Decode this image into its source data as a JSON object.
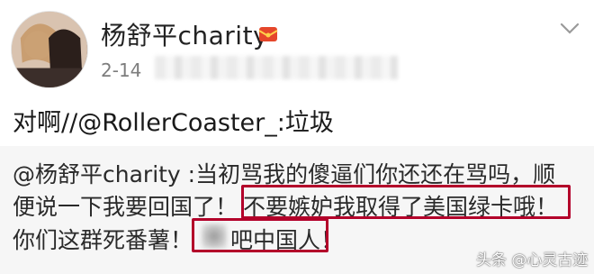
{
  "post": {
    "username": "杨舒平charity",
    "icons": {
      "badge": "vip-envelope-icon",
      "menu": "chevron-down-icon",
      "avatar": "profile-photo"
    },
    "date": "2-14",
    "repost_text_prefix": "对啊//",
    "repost_mention": "@RollerCoaster_",
    "repost_text_suffix": ":垃圾",
    "quoted": {
      "line1": "@杨舒平charity :当初骂我的傻逼们你还还在骂吗，顺",
      "line2_a": "便说一下我要回国了！",
      "line2_b": "不要嫉妒我取得了美国绿卡哦！",
      "line3_a": "你们这群死番薯！",
      "line3_b": "吧中国人！"
    },
    "highlight_color": "#b3002a"
  },
  "watermark": "头条 @心灵古迹"
}
